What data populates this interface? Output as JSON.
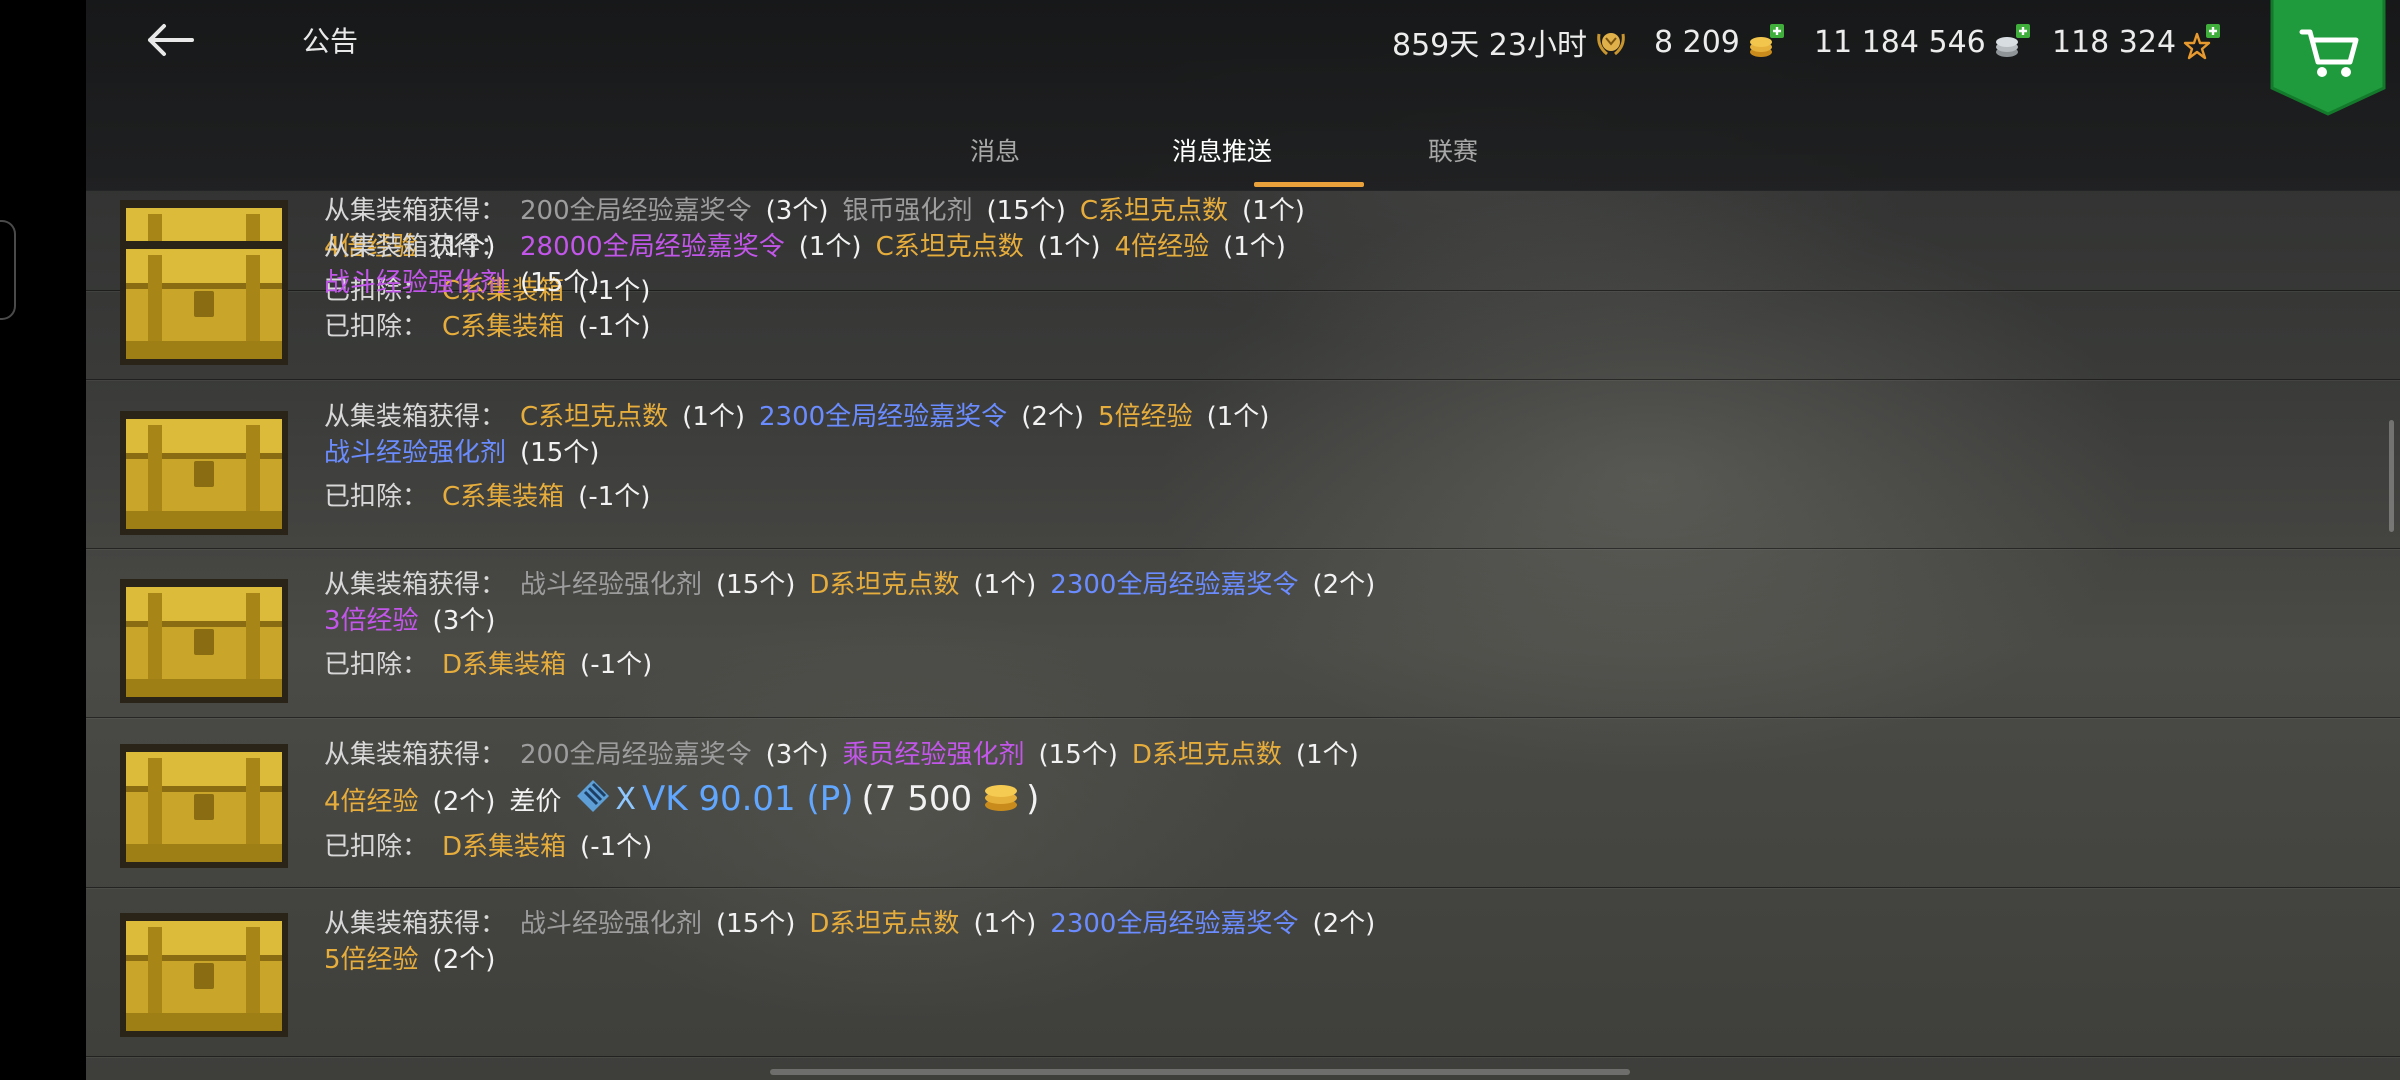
{
  "header": {
    "title": "公告",
    "premium_time": "859天 23小时",
    "gold": "8 209",
    "credits": "11 184 546",
    "free_xp": "118 324"
  },
  "tabs": [
    {
      "label": "消息",
      "active": false
    },
    {
      "label": "消息推送",
      "active": true
    },
    {
      "label": "联赛",
      "active": false
    }
  ],
  "colors": {
    "orange": "#e6ad3c",
    "purple": "#c356ea",
    "blue": "#6b8cff",
    "gray": "#9d9d9d",
    "tab_underline": "#e9a23b",
    "shop_green": "#1f9a3c"
  },
  "rows": [
    {
      "lines": [
        [
          [
            "从集装箱获得：",
            "label"
          ],
          [
            "200全局经验嘉奖令",
            "gray"
          ],
          [
            "(3个)",
            "qty"
          ],
          [
            "银币强化剂",
            "gray"
          ],
          [
            "(15个)",
            "qty"
          ],
          [
            "C系坦克点数",
            "orange"
          ],
          [
            "(1个)",
            "qty"
          ]
        ],
        [
          [
            "4倍经验",
            "orange"
          ],
          [
            "(1个)",
            "qty"
          ]
        ],
        [
          [
            "已扣除：",
            "label"
          ],
          [
            "C系集装箱",
            "orange"
          ],
          [
            "(-1个)",
            "qty"
          ]
        ]
      ]
    },
    {
      "lines": [
        [
          [
            "从集装箱获得：",
            "label"
          ],
          [
            "28000全局经验嘉奖令",
            "purple"
          ],
          [
            "(1个)",
            "qty"
          ],
          [
            "C系坦克点数",
            "orange"
          ],
          [
            "(1个)",
            "qty"
          ],
          [
            "4倍经验",
            "orange"
          ],
          [
            "(1个)",
            "qty"
          ]
        ],
        [
          [
            "战斗经验强化剂",
            "purple"
          ],
          [
            "(15个)",
            "qty"
          ]
        ],
        [
          [
            "已扣除：",
            "label"
          ],
          [
            "C系集装箱",
            "orange"
          ],
          [
            "(-1个)",
            "qty"
          ]
        ]
      ]
    },
    {
      "lines": [
        [
          [
            "从集装箱获得：",
            "label"
          ],
          [
            "C系坦克点数",
            "orange"
          ],
          [
            "(1个)",
            "qty"
          ],
          [
            "2300全局经验嘉奖令",
            "blue"
          ],
          [
            "(2个)",
            "qty"
          ],
          [
            "5倍经验",
            "orange"
          ],
          [
            "(1个)",
            "qty"
          ]
        ],
        [
          [
            "战斗经验强化剂",
            "blue"
          ],
          [
            "(15个)",
            "qty"
          ]
        ],
        [
          [
            "已扣除：",
            "label"
          ],
          [
            "C系集装箱",
            "orange"
          ],
          [
            "(-1个)",
            "qty"
          ]
        ]
      ]
    },
    {
      "lines": [
        [
          [
            "从集装箱获得：",
            "label"
          ],
          [
            "战斗经验强化剂",
            "gray"
          ],
          [
            "(15个)",
            "qty"
          ],
          [
            "D系坦克点数",
            "orange"
          ],
          [
            "(1个)",
            "qty"
          ],
          [
            "2300全局经验嘉奖令",
            "blue"
          ],
          [
            "(2个)",
            "qty"
          ]
        ],
        [
          [
            "3倍经验",
            "purple"
          ],
          [
            "(3个)",
            "qty"
          ]
        ],
        [
          [
            "已扣除：",
            "label"
          ],
          [
            "D系集装箱",
            "orange"
          ],
          [
            "(-1个)",
            "qty"
          ]
        ]
      ]
    },
    {
      "lines": [
        [
          [
            "从集装箱获得：",
            "label"
          ],
          [
            "200全局经验嘉奖令",
            "gray"
          ],
          [
            "(3个)",
            "qty"
          ],
          [
            "乘员经验强化剂",
            "purple"
          ],
          [
            "(15个)",
            "qty"
          ],
          [
            "D系坦克点数",
            "orange"
          ],
          [
            "(1个)",
            "qty"
          ]
        ],
        [
          [
            "已扣除：",
            "label"
          ],
          [
            "D系集装箱",
            "orange"
          ],
          [
            "(-1个)",
            "qty"
          ]
        ]
      ],
      "compensation": {
        "reward": "4倍经验",
        "reward_qty": "(2个)",
        "label": "差价",
        "tank_tier": "X",
        "tank_name": "VK 90.01 (P)",
        "price_open": "(7 500",
        "price_close": ")"
      }
    },
    {
      "lines": [
        [
          [
            "从集装箱获得：",
            "label"
          ],
          [
            "战斗经验强化剂",
            "gray"
          ],
          [
            "(15个)",
            "qty"
          ],
          [
            "D系坦克点数",
            "orange"
          ],
          [
            "(1个)",
            "qty"
          ],
          [
            "2300全局经验嘉奖令",
            "blue"
          ],
          [
            "(2个)",
            "qty"
          ]
        ],
        [
          [
            "5倍经验",
            "orange"
          ],
          [
            "(2个)",
            "qty"
          ]
        ]
      ]
    }
  ]
}
